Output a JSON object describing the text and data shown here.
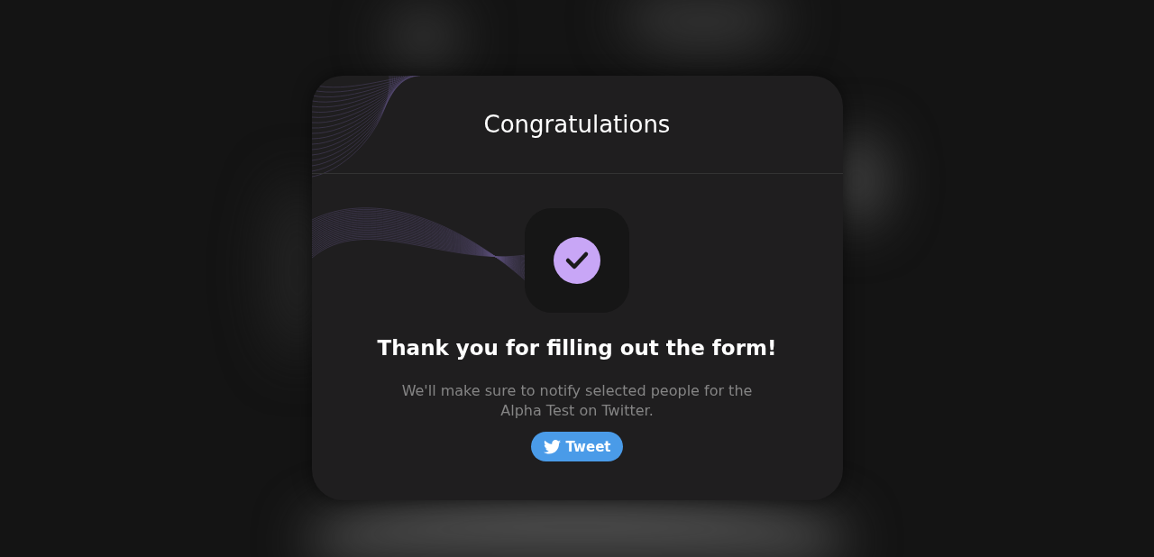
{
  "dialog": {
    "title": "Congratulations",
    "heading": "Thank you for filling out the form!",
    "message": "We'll make sure to notify selected people for the Alpha Test on Twitter.",
    "button": {
      "label": "Tweet"
    }
  }
}
